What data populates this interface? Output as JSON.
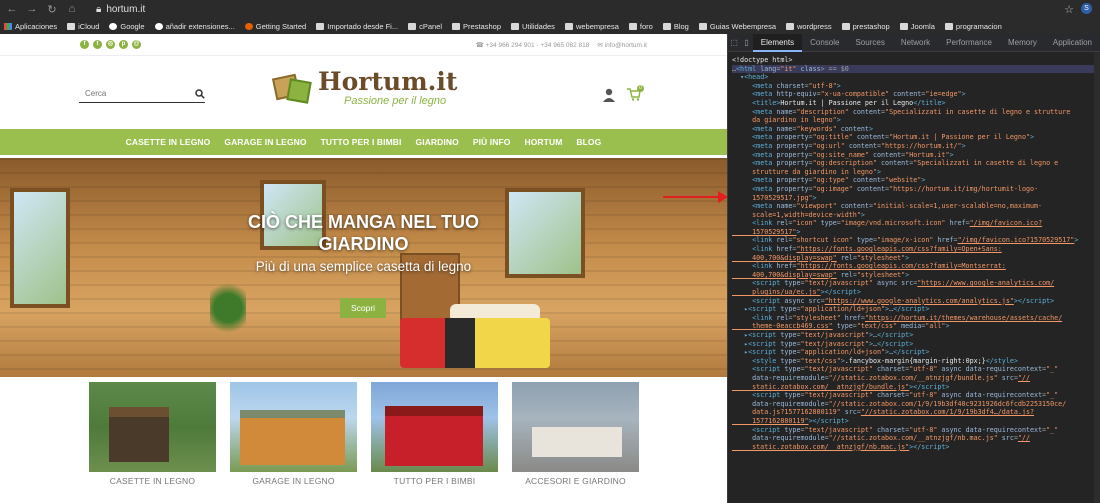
{
  "browser": {
    "url": "hortum.it",
    "bookmarks": [
      "Aplicaciones",
      "iCloud",
      "Google",
      "añadir extensiones...",
      "Getting Started",
      "Importado desde Fi...",
      "cPanel",
      "Prestashop",
      "Utilidades",
      "webempresa",
      "foro",
      "Blog",
      "Guias Webempresa",
      "wordpress",
      "prestashop",
      "Joomla",
      "programacion"
    ]
  },
  "site": {
    "phone": "+34 966 294 901 · +34 965 082 818",
    "email": "info@hortum.it",
    "search_placeholder": "Cerca",
    "logo_title": "Hortum.it",
    "logo_tagline": "Passione per il legno",
    "cart_count": "0",
    "nav": [
      "CASETTE IN LEGNO",
      "GARAGE IN LEGNO",
      "TUTTO PER I BIMBI",
      "GIARDINO",
      "PIÙ INFO",
      "HORTUM",
      "BLOG"
    ],
    "hero": {
      "title_line1": "CIÒ CHE MANGA NEL TUO",
      "title_line2": "GIARDINO",
      "subtitle": "Più di una semplice casetta di legno",
      "button": "Scopri"
    },
    "categories": [
      "CASETTE IN LEGNO",
      "GARAGE IN LEGNO",
      "TUTTO PER I BIMBI",
      "ACCESORI E GIARDINO"
    ]
  },
  "devtools": {
    "tabs": [
      "Elements",
      "Console",
      "Sources",
      "Network",
      "Performance",
      "Memory",
      "Application"
    ],
    "active_tab": "Elements"
  }
}
